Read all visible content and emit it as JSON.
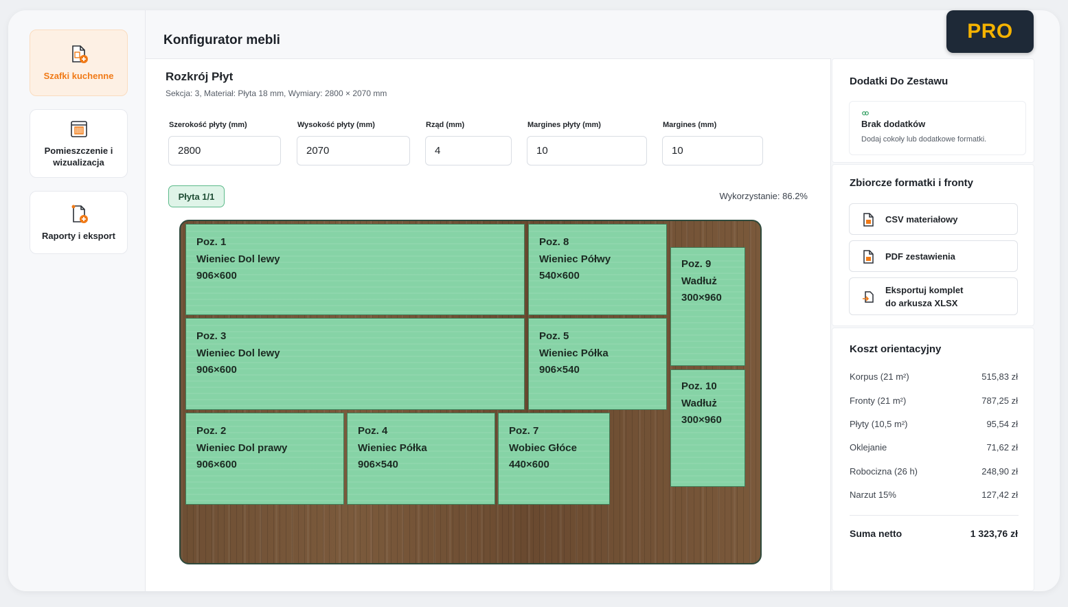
{
  "pro_badge": "PRO",
  "sidebar": {
    "items": [
      {
        "label": "Szafki kuchenne",
        "icon": "cabinet-doc-icon",
        "active": true
      },
      {
        "label": "Pomieszczenie i wizualizacja",
        "icon": "room-visual-icon",
        "active": false
      },
      {
        "label": "Raporty i eksport",
        "icon": "report-doc-icon",
        "active": false
      }
    ]
  },
  "header": {
    "title": "Konfigurator mebli"
  },
  "cut": {
    "title": "Rozkrój Płyt",
    "subtitle": "Sekcja: 3, Materiał: Płyta 18 mm, Wymiary: 2800 × 2070 mm",
    "fields": [
      {
        "label": "Szerokość płyty (mm)",
        "value": "2800"
      },
      {
        "label": "Wysokość płyty (mm)",
        "value": "2070"
      },
      {
        "label": "Rząd (mm)",
        "value": "4"
      },
      {
        "label": "Margines płyty (mm)",
        "value": "10"
      },
      {
        "label": "Margines (mm)",
        "value": "10"
      }
    ],
    "plate_label": "Płyta 1/1",
    "usage": "Wykorzystanie: 86.2%",
    "pieces": [
      {
        "pos": "Poz. 1",
        "name": "Wieniec Dol lewy",
        "dims": "906×600"
      },
      {
        "pos": "Poz. 8",
        "name": "Wieniec Półwy",
        "dims": "540×600"
      },
      {
        "pos": "Poz. 9",
        "name": "Wadłuż",
        "dims": "300×960"
      },
      {
        "pos": "Poz. 3",
        "name": "Wieniec Dol lewy",
        "dims": "906×600"
      },
      {
        "pos": "Poz. 5",
        "name": "Wieniec Półka",
        "dims": "906×540"
      },
      {
        "pos": "Poz. 10",
        "name": "Wadłuż",
        "dims": "300×960"
      },
      {
        "pos": "Poz. 2",
        "name": "Wieniec Dol prawy",
        "dims": "906×600"
      },
      {
        "pos": "Poz. 4",
        "name": "Wieniec Półka",
        "dims": "906×540"
      },
      {
        "pos": "Poz. 7",
        "name": "Wobiec Głóce",
        "dims": "440×600"
      }
    ]
  },
  "addons": {
    "title": "Dodatki Do Zestawu",
    "empty_title": "Brak dodatków",
    "empty_desc": "Dodaj cokoły lub dodatkowe formatki."
  },
  "exports": {
    "title": "Zbiorcze formatki i fronty",
    "buttons": [
      {
        "label": "CSV materiałowy",
        "icon": "csv-file-icon"
      },
      {
        "label": "PDF zestawienia",
        "icon": "pdf-file-icon"
      },
      {
        "label_line1": "Eksportuj komplet",
        "label_line2": "do arkusza XLSX",
        "icon": "xlsx-export-icon"
      }
    ]
  },
  "cost": {
    "title": "Koszt orientacyjny",
    "rows": [
      {
        "label": "Korpus (21 m²)",
        "value": "515,83 zł"
      },
      {
        "label": "Fronty (21 m²)",
        "value": "787,25 zł"
      },
      {
        "label": "Płyty (10,5 m²)",
        "value": "95,54 zł"
      },
      {
        "label": "Oklejanie",
        "value": "71,62 zł"
      },
      {
        "label": "Robocizna (26 h)",
        "value": "248,90 zł"
      },
      {
        "label": "Narzut 15%",
        "value": "127,42 zł"
      }
    ],
    "total_label": "Suma netto",
    "total_value": "1 323,76 zł"
  },
  "colors": {
    "accent": "#f07a17",
    "piece": "#86d3a6",
    "pro_bg": "#1e2937",
    "pro_text": "#f5b301"
  }
}
